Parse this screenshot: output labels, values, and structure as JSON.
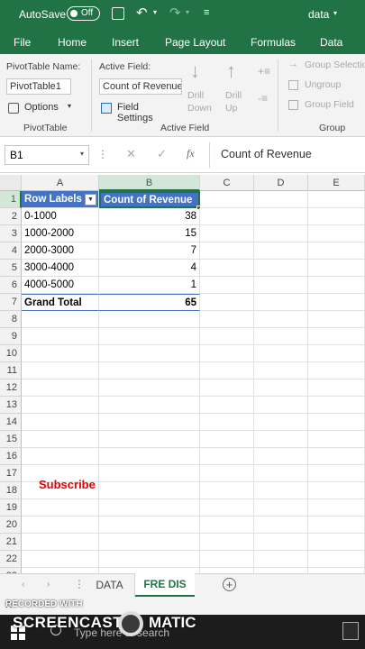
{
  "titlebar": {
    "autosave_label": "AutoSave",
    "autosave_state": "Off",
    "filename": "data"
  },
  "ribbon_tabs": [
    "File",
    "Home",
    "Insert",
    "Page Layout",
    "Formulas",
    "Data"
  ],
  "pivot": {
    "name_label": "PivotTable Name:",
    "name_value": "PivotTable1",
    "options_label": "Options",
    "group_label": "PivotTable"
  },
  "active_field": {
    "label": "Active Field:",
    "value": "Count of Revenue",
    "settings_label": "Field Settings",
    "drill_down": "Drill Down",
    "drill_up": "Drill Up",
    "group_label": "Active Field"
  },
  "group": {
    "selection_label": "Group Selection",
    "ungroup_label": "Ungroup",
    "field_label": "Group Field",
    "group_label": "Group"
  },
  "formula_bar": {
    "name_box": "B1",
    "fx": "fx",
    "content": "Count of Revenue"
  },
  "columns": [
    "A",
    "B",
    "C",
    "D",
    "E"
  ],
  "rows": [
    "1",
    "2",
    "3",
    "4",
    "5",
    "6",
    "7",
    "8",
    "9",
    "10",
    "11",
    "12",
    "13",
    "14",
    "15",
    "16",
    "17",
    "18",
    "19",
    "20",
    "21",
    "22",
    "23"
  ],
  "pivot_table": {
    "header_a": "Row Labels",
    "header_b": "Count of Revenue",
    "data": [
      {
        "label": "0-1000",
        "value": "38"
      },
      {
        "label": "1000-2000",
        "value": "15"
      },
      {
        "label": "2000-3000",
        "value": "7"
      },
      {
        "label": "3000-4000",
        "value": "4"
      },
      {
        "label": "4000-5000",
        "value": "1"
      }
    ],
    "total_label": "Grand Total",
    "total_value": "65"
  },
  "subscribe_text": "Subscribe",
  "sheet_tabs": [
    "DATA",
    "FRE DIS"
  ],
  "active_sheet": "FRE DIS",
  "status_text": "R",
  "watermark": {
    "line1": "RECORDED WITH",
    "line2": "SCREENCAST",
    "line3": "MATIC"
  },
  "taskbar": {
    "search_placeholder": "Type here to search"
  },
  "colors": {
    "excel_green": "#217346",
    "pivot_header": "#4472c4",
    "subscribe": "#e00000"
  }
}
